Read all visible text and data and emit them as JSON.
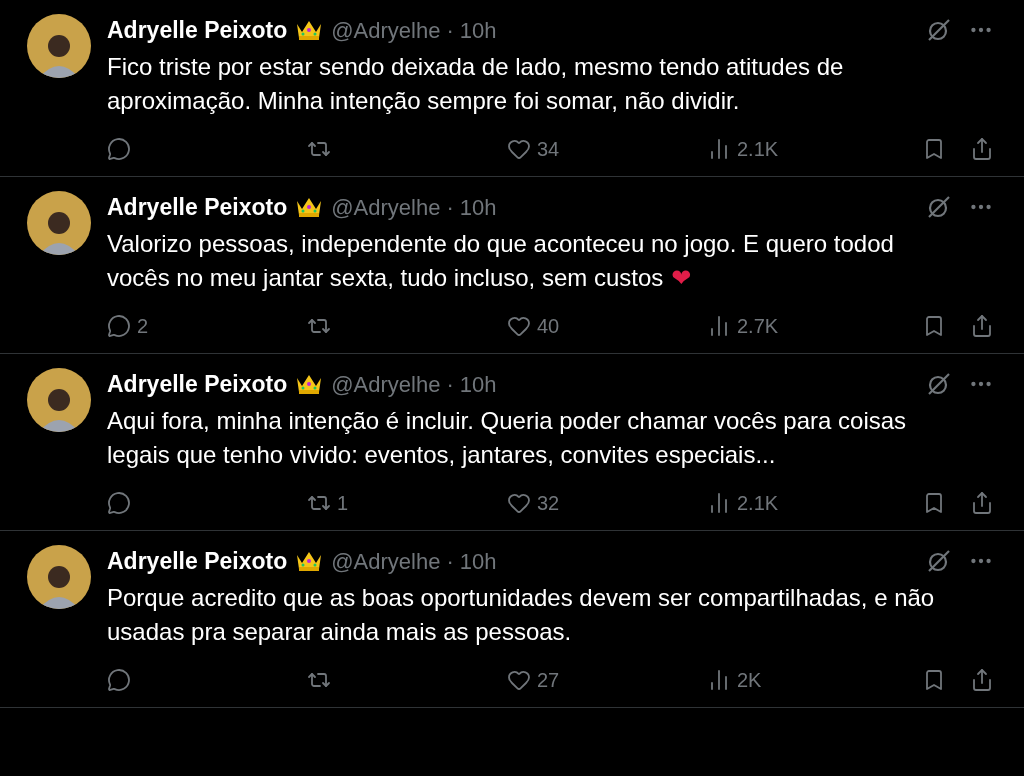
{
  "tweets": [
    {
      "name": "Adryelle Peixoto",
      "handle": "@Adryelhe",
      "separator": "·",
      "time": "10h",
      "text": "Fico triste por estar sendo deixada de lado, mesmo tendo atitudes de aproximação. Minha intenção sempre foi somar, não dividir.",
      "likes": "34",
      "views": "2.1K"
    },
    {
      "name": "Adryelle Peixoto",
      "handle": "@Adryelhe",
      "separator": "·",
      "time": "10h",
      "text": "Valorizo pessoas, independente do que aconteceu no jogo. E quero todod vocês no meu jantar sexta, tudo incluso, sem custos",
      "emoji": "❤",
      "replies": "2",
      "likes": "40",
      "views": "2.7K"
    },
    {
      "name": "Adryelle Peixoto",
      "handle": "@Adryelhe",
      "separator": "·",
      "time": "10h",
      "text": "Aqui fora, minha intenção é incluir. Queria poder chamar vocês para coisas legais que tenho vivido: eventos, jantares, convites especiais...",
      "retweets": "1",
      "likes": "32",
      "views": "2.1K"
    },
    {
      "name": "Adryelle Peixoto",
      "handle": "@Adryelhe",
      "separator": "·",
      "time": "10h",
      "text": "Porque acredito que as boas oportunidades devem ser compartilhadas, e não usadas pra separar ainda mais as pessoas.",
      "likes": "27",
      "views": "2K"
    }
  ]
}
